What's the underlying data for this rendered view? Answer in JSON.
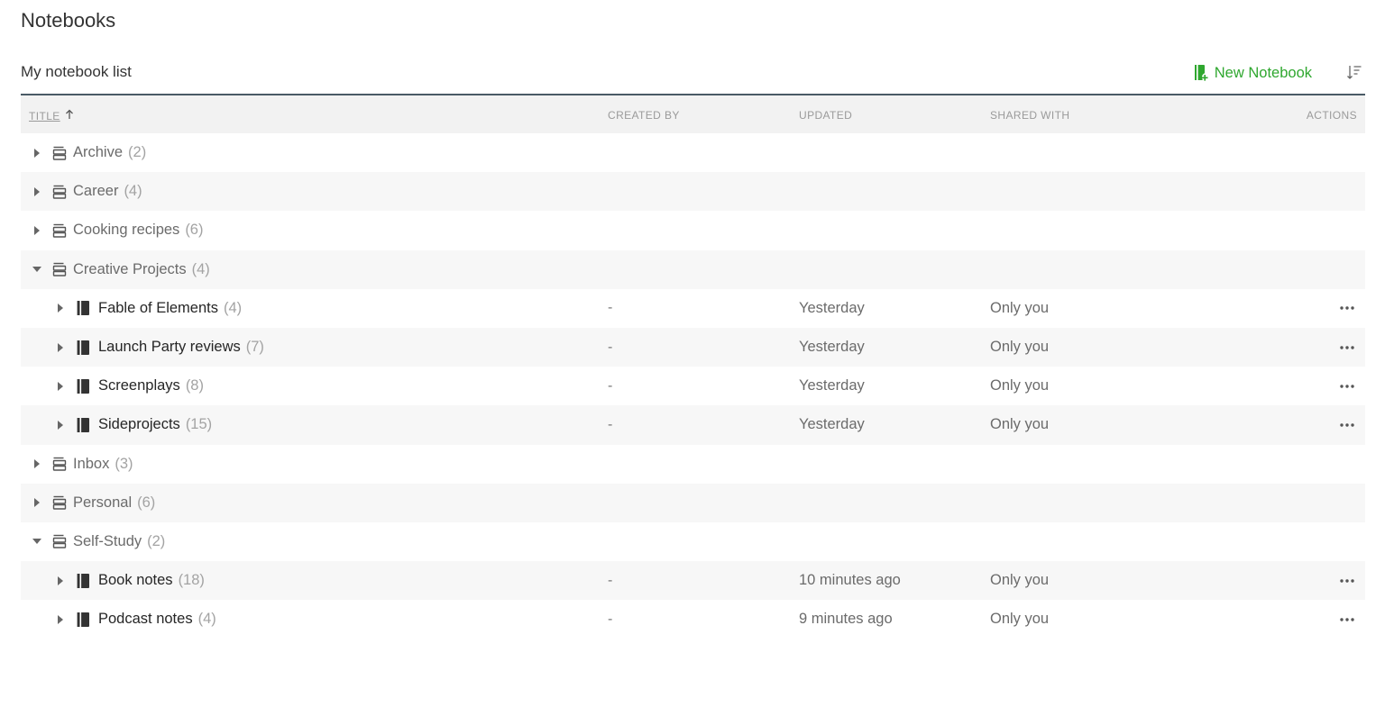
{
  "page": {
    "title": "Notebooks"
  },
  "list": {
    "heading": "My notebook list",
    "new_notebook_label": "New Notebook",
    "accent_color": "#2fa72f"
  },
  "columns": {
    "title": "TITLE",
    "created_by": "CREATED BY",
    "updated": "UPDATED",
    "shared_with": "SHARED WITH",
    "actions": "ACTIONS",
    "sort_indicator": "ascending"
  },
  "rows": [
    {
      "type": "stack",
      "name": "Archive",
      "count": "(2)",
      "expanded": false
    },
    {
      "type": "stack",
      "name": "Career",
      "count": "(4)",
      "expanded": false
    },
    {
      "type": "stack",
      "name": "Cooking recipes",
      "count": "(6)",
      "expanded": false
    },
    {
      "type": "stack",
      "name": "Creative Projects",
      "count": "(4)",
      "expanded": true
    },
    {
      "type": "notebook",
      "name": "Fable of Elements",
      "count": "(4)",
      "created_by": "-",
      "updated": "Yesterday",
      "shared_with": "Only you"
    },
    {
      "type": "notebook",
      "name": "Launch Party reviews",
      "count": "(7)",
      "created_by": "-",
      "updated": "Yesterday",
      "shared_with": "Only you"
    },
    {
      "type": "notebook",
      "name": "Screenplays",
      "count": "(8)",
      "created_by": "-",
      "updated": "Yesterday",
      "shared_with": "Only you"
    },
    {
      "type": "notebook",
      "name": "Sideprojects",
      "count": "(15)",
      "created_by": "-",
      "updated": "Yesterday",
      "shared_with": "Only you"
    },
    {
      "type": "stack",
      "name": "Inbox",
      "count": "(3)",
      "expanded": false
    },
    {
      "type": "stack",
      "name": "Personal",
      "count": "(6)",
      "expanded": false
    },
    {
      "type": "stack",
      "name": "Self-Study",
      "count": "(2)",
      "expanded": true
    },
    {
      "type": "notebook",
      "name": "Book notes",
      "count": "(18)",
      "created_by": "-",
      "updated": "10 minutes ago",
      "shared_with": "Only you"
    },
    {
      "type": "notebook",
      "name": "Podcast notes",
      "count": "(4)",
      "created_by": "-",
      "updated": "9 minutes ago",
      "shared_with": "Only you"
    }
  ],
  "icons": {
    "stack": "stack-icon",
    "notebook": "notebook-icon",
    "expand": "caret-right-icon",
    "collapse": "caret-down-icon",
    "more": "more-icon",
    "sort": "sort-icon",
    "new": "new-notebook-icon"
  }
}
